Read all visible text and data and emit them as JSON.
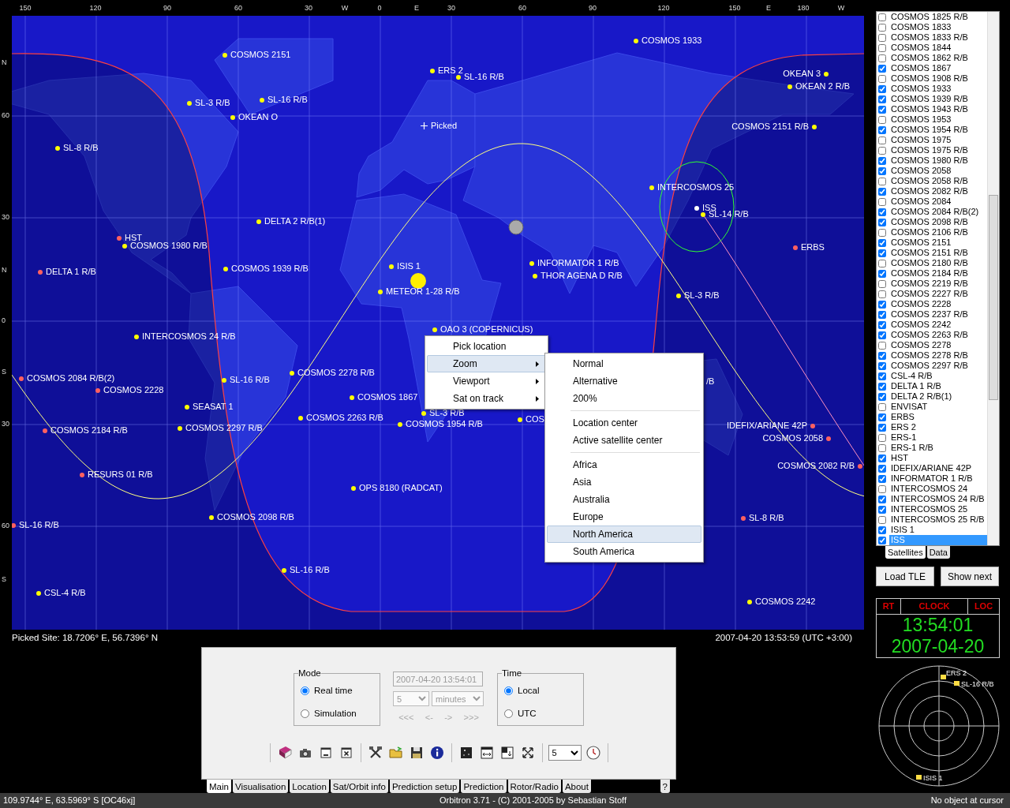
{
  "map": {
    "top_axis": [
      "150",
      "120",
      "90",
      "60",
      "30",
      "W",
      "0",
      "E",
      "30",
      "60",
      "90",
      "120",
      "150",
      "E",
      "180",
      "W"
    ],
    "left_axis": [
      "N",
      "60",
      "30",
      "N",
      "0",
      "S",
      "30",
      "60",
      "S"
    ],
    "picked_marker": {
      "label": "Picked"
    },
    "satellites": [
      {
        "label": "COSMOS 1933",
        "color": "#ffff00"
      },
      {
        "label": "COSMOS 2151",
        "color": "#ffff00"
      },
      {
        "label": "ERS 2",
        "color": "#ffff00"
      },
      {
        "label": "SL-16 R/B",
        "color": "#ffff00"
      },
      {
        "label": "OKEAN 3",
        "color": "#ffff00"
      },
      {
        "label": "OKEAN 2 R/B",
        "color": "#ffff00"
      },
      {
        "label": "SL-16 R/B",
        "color": "#ffff00"
      },
      {
        "label": "SL-3 R/B",
        "color": "#ffff00"
      },
      {
        "label": "OKEAN O",
        "color": "#ffff00"
      },
      {
        "label": "COSMOS 2151 R/B",
        "color": "#ffff00"
      },
      {
        "label": "SL-8 R/B",
        "color": "#ffff00"
      },
      {
        "label": "INTERCOSMOS 25",
        "color": "#ffff00"
      },
      {
        "label": "ISS",
        "color": "#ffffff"
      },
      {
        "label": "SL-14 R/B",
        "color": "#ffff00"
      },
      {
        "label": "DELTA 2 R/B(1)",
        "color": "#ffff00"
      },
      {
        "label": "HST",
        "color": "#ff6060"
      },
      {
        "label": "COSMOS 1980 R/B",
        "color": "#ffff00"
      },
      {
        "label": "ERBS",
        "color": "#ff6060"
      },
      {
        "label": "ISIS 1",
        "color": "#ffff00"
      },
      {
        "label": "INFORMATOR 1 R/B",
        "color": "#ffff00"
      },
      {
        "label": "DELTA 1 R/B",
        "color": "#ff6060"
      },
      {
        "label": "COSMOS 1939 R/B",
        "color": "#ffff00"
      },
      {
        "label": "THOR AGENA D R/B",
        "color": "#ffff00"
      },
      {
        "label": "METEOR 1-28 R/B",
        "color": "#ffff00"
      },
      {
        "label": "SL-3 R/B",
        "color": "#ffff00"
      },
      {
        "label": "OAO 3 (COPERNICUS)",
        "color": "#ffff00"
      },
      {
        "label": "INTERCOSMOS 24 R/B",
        "color": "#ffff00"
      },
      {
        "label": "COSMOS 2278 R/B",
        "color": "#ffff00"
      },
      {
        "label": "COSMOS 2084 R/B(2)",
        "color": "#ff6060"
      },
      {
        "label": "SL-16 R/B",
        "color": "#ffff00"
      },
      {
        "label": "/B"
      },
      {
        "label": "COSMOS 2228",
        "color": "#ff6060"
      },
      {
        "label": "COSMOS 1867",
        "color": "#ffff00"
      },
      {
        "label": "SEASAT 1",
        "color": "#ffff00"
      },
      {
        "label": "SL-3 R/B",
        "color": "#ffff00"
      },
      {
        "label": "COSMOS 2263 R/B",
        "color": "#ffff00"
      },
      {
        "label": "COSMOS 1954 R/B",
        "color": "#ffff00"
      },
      {
        "label": "COS",
        "color": "#ffff00"
      },
      {
        "label": "COSMOS 2297 R/B",
        "color": "#ffff00"
      },
      {
        "label": "IDEFIX/ARIANE 42P",
        "color": "#ff6060"
      },
      {
        "label": "COSMOS 2184 R/B",
        "color": "#ff6060"
      },
      {
        "label": "COSMOS 2058",
        "color": "#ff6060"
      },
      {
        "label": "RESURS 01 R/B",
        "color": "#ff6060"
      },
      {
        "label": "COSMOS 2082 R/B",
        "color": "#ff6060"
      },
      {
        "label": "OPS 8180 (RADCAT)",
        "color": "#ffff00"
      },
      {
        "label": "COSMOS 2098 R/B",
        "color": "#ffff00"
      },
      {
        "label": "SL-8 R/B",
        "color": "#ff6060"
      },
      {
        "label": "SL-16 R/B",
        "color": "#ff6060"
      },
      {
        "label": "SL-16 R/B",
        "color": "#ffff00"
      },
      {
        "label": "CSL-4 R/B",
        "color": "#ffff00"
      },
      {
        "label": "COSMOS 2242",
        "color": "#ffff00"
      }
    ],
    "picked_site": "Picked Site: 18.7206° E, 56.7396° N",
    "timestamp": "2007-04-20 13:53:59 (UTC +3:00)"
  },
  "context_menu": {
    "items": [
      {
        "label": "Pick location",
        "submenu": false,
        "selected": false
      },
      {
        "label": "Zoom",
        "submenu": true,
        "selected": true
      },
      {
        "label": "Viewport",
        "submenu": true,
        "selected": false
      },
      {
        "label": "Sat on track",
        "submenu": true,
        "selected": false
      }
    ]
  },
  "zoom_submenu": {
    "groups": [
      [
        {
          "label": "Normal",
          "selected": false
        },
        {
          "label": "Alternative",
          "selected": false
        },
        {
          "label": "200%",
          "selected": false
        }
      ],
      [
        {
          "label": "Location center",
          "selected": false
        },
        {
          "label": "Active satellite center",
          "selected": false
        }
      ],
      [
        {
          "label": "Africa",
          "selected": false
        },
        {
          "label": "Asia",
          "selected": false
        },
        {
          "label": "Australia",
          "selected": false
        },
        {
          "label": "Europe",
          "selected": false
        },
        {
          "label": "North America",
          "selected": true
        },
        {
          "label": "South America",
          "selected": false
        }
      ]
    ]
  },
  "satellite_list": {
    "items": [
      {
        "name": "COSMOS 1825 R/B",
        "checked": false,
        "selected": false
      },
      {
        "name": "COSMOS 1833",
        "checked": false,
        "selected": false
      },
      {
        "name": "COSMOS 1833 R/B",
        "checked": false,
        "selected": false
      },
      {
        "name": "COSMOS 1844",
        "checked": false,
        "selected": false
      },
      {
        "name": "COSMOS 1862 R/B",
        "checked": false,
        "selected": false
      },
      {
        "name": "COSMOS 1867",
        "checked": true,
        "selected": false
      },
      {
        "name": "COSMOS 1908 R/B",
        "checked": false,
        "selected": false
      },
      {
        "name": "COSMOS 1933",
        "checked": true,
        "selected": false
      },
      {
        "name": "COSMOS 1939 R/B",
        "checked": true,
        "selected": false
      },
      {
        "name": "COSMOS 1943 R/B",
        "checked": true,
        "selected": false
      },
      {
        "name": "COSMOS 1953",
        "checked": false,
        "selected": false
      },
      {
        "name": "COSMOS 1954 R/B",
        "checked": true,
        "selected": false
      },
      {
        "name": "COSMOS 1975",
        "checked": false,
        "selected": false
      },
      {
        "name": "COSMOS 1975 R/B",
        "checked": false,
        "selected": false
      },
      {
        "name": "COSMOS 1980 R/B",
        "checked": true,
        "selected": false
      },
      {
        "name": "COSMOS 2058",
        "checked": true,
        "selected": false
      },
      {
        "name": "COSMOS 2058 R/B",
        "checked": false,
        "selected": false
      },
      {
        "name": "COSMOS 2082 R/B",
        "checked": true,
        "selected": false
      },
      {
        "name": "COSMOS 2084",
        "checked": false,
        "selected": false
      },
      {
        "name": "COSMOS 2084 R/B(2)",
        "checked": true,
        "selected": false
      },
      {
        "name": "COSMOS 2098 R/B",
        "checked": true,
        "selected": false
      },
      {
        "name": "COSMOS 2106 R/B",
        "checked": false,
        "selected": false
      },
      {
        "name": "COSMOS 2151",
        "checked": true,
        "selected": false
      },
      {
        "name": "COSMOS 2151 R/B",
        "checked": true,
        "selected": false
      },
      {
        "name": "COSMOS 2180 R/B",
        "checked": false,
        "selected": false
      },
      {
        "name": "COSMOS 2184 R/B",
        "checked": true,
        "selected": false
      },
      {
        "name": "COSMOS 2219 R/B",
        "checked": false,
        "selected": false
      },
      {
        "name": "COSMOS 2227 R/B",
        "checked": false,
        "selected": false
      },
      {
        "name": "COSMOS 2228",
        "checked": true,
        "selected": false
      },
      {
        "name": "COSMOS 2237 R/B",
        "checked": true,
        "selected": false
      },
      {
        "name": "COSMOS 2242",
        "checked": true,
        "selected": false
      },
      {
        "name": "COSMOS 2263 R/B",
        "checked": true,
        "selected": false
      },
      {
        "name": "COSMOS 2278",
        "checked": false,
        "selected": false
      },
      {
        "name": "COSMOS 2278 R/B",
        "checked": true,
        "selected": false
      },
      {
        "name": "COSMOS 2297 R/B",
        "checked": true,
        "selected": false
      },
      {
        "name": "CSL-4 R/B",
        "checked": true,
        "selected": false
      },
      {
        "name": "DELTA 1 R/B",
        "checked": true,
        "selected": false
      },
      {
        "name": "DELTA 2 R/B(1)",
        "checked": true,
        "selected": false
      },
      {
        "name": "ENVISAT",
        "checked": false,
        "selected": false
      },
      {
        "name": "ERBS",
        "checked": true,
        "selected": false
      },
      {
        "name": "ERS 2",
        "checked": true,
        "selected": false
      },
      {
        "name": "ERS-1",
        "checked": false,
        "selected": false
      },
      {
        "name": "ERS-1 R/B",
        "checked": false,
        "selected": false
      },
      {
        "name": "HST",
        "checked": true,
        "selected": false
      },
      {
        "name": "IDEFIX/ARIANE 42P",
        "checked": true,
        "selected": false
      },
      {
        "name": "INFORMATOR 1 R/B",
        "checked": true,
        "selected": false
      },
      {
        "name": "INTERCOSMOS 24",
        "checked": false,
        "selected": false
      },
      {
        "name": "INTERCOSMOS 24 R/B",
        "checked": true,
        "selected": false
      },
      {
        "name": "INTERCOSMOS 25",
        "checked": true,
        "selected": false
      },
      {
        "name": "INTERCOSMOS 25 R/B",
        "checked": false,
        "selected": false
      },
      {
        "name": "ISIS 1",
        "checked": true,
        "selected": false
      },
      {
        "name": "ISS",
        "checked": true,
        "selected": true
      }
    ],
    "tabs": [
      {
        "label": "Satellites",
        "selected": true
      },
      {
        "label": "Data",
        "selected": false
      }
    ]
  },
  "side_buttons": [
    "Load TLE",
    "Show next"
  ],
  "clock": {
    "header": [
      "RT",
      "CLOCK",
      "LOC"
    ],
    "time": "13:54:01",
    "date": "2007-04-20"
  },
  "radar": {
    "satellites": [
      {
        "label": "ERS 2"
      },
      {
        "label": "SL-16 R/B"
      },
      {
        "label": "ISIS 1"
      }
    ]
  },
  "control_panel": {
    "mode": {
      "title": "Mode",
      "options": [
        {
          "label": "Real time",
          "selected": true
        },
        {
          "label": "Simulation",
          "selected": false
        }
      ]
    },
    "sim_time": {
      "value": "2007-04-20 13:54:01",
      "step": "5",
      "unit": "minutes",
      "nav": [
        "<<<",
        "<-",
        "->",
        ">>>"
      ],
      "disabled": true
    },
    "time": {
      "title": "Time",
      "options": [
        {
          "label": "Local",
          "selected": true
        },
        {
          "label": "UTC",
          "selected": false
        }
      ]
    },
    "toolbar_select": "5",
    "tabs": [
      {
        "label": "Main",
        "selected": true
      },
      {
        "label": "Visualisation",
        "selected": false
      },
      {
        "label": "Location",
        "selected": false
      },
      {
        "label": "Sat/Orbit info",
        "selected": false
      },
      {
        "label": "Prediction setup",
        "selected": false
      },
      {
        "label": "Prediction",
        "selected": false
      },
      {
        "label": "Rotor/Radio",
        "selected": false
      },
      {
        "label": "About",
        "selected": false
      }
    ],
    "help_tab": "?"
  },
  "status_bar": {
    "cursor": "109.9744° E, 63.5969° S [OC46xj]",
    "title": "Orbitron 3.71 - (C) 2001-2005 by Sebastian Stoff",
    "object": "No object at cursor"
  }
}
